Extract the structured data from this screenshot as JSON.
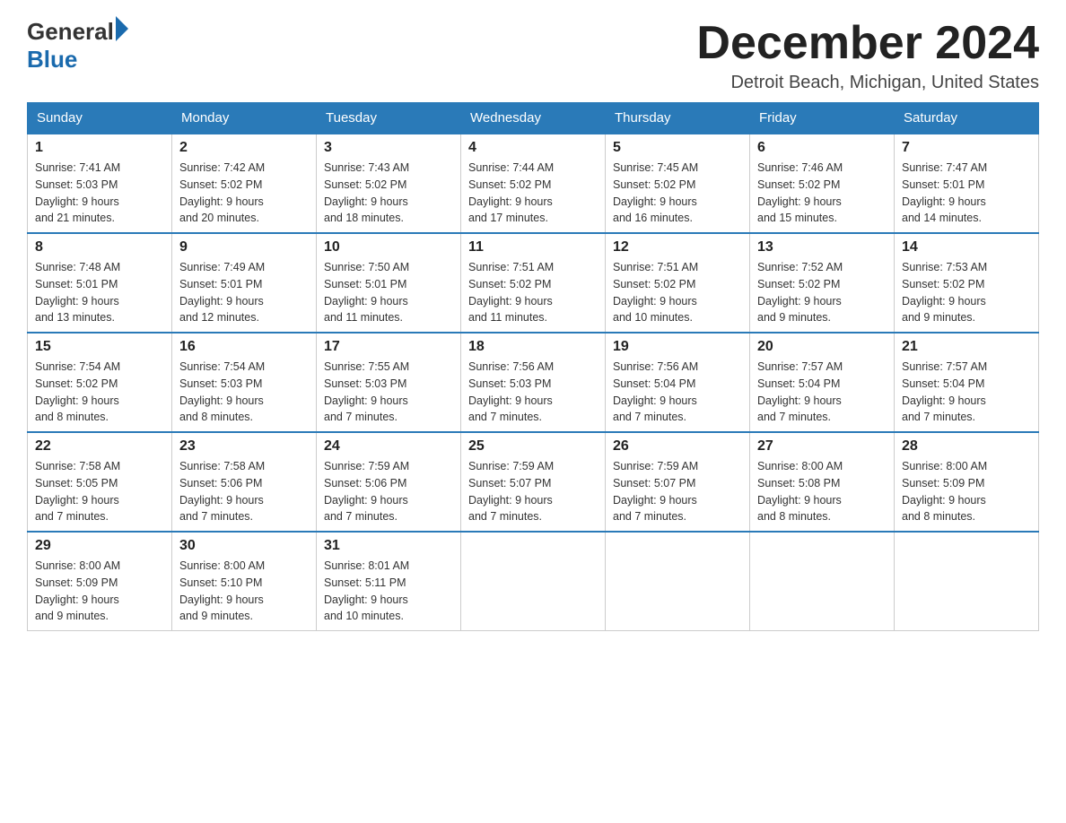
{
  "header": {
    "logo_general": "General",
    "logo_blue": "Blue",
    "month_title": "December 2024",
    "location": "Detroit Beach, Michigan, United States"
  },
  "days_of_week": [
    "Sunday",
    "Monday",
    "Tuesday",
    "Wednesday",
    "Thursday",
    "Friday",
    "Saturday"
  ],
  "weeks": [
    [
      {
        "day": "1",
        "sunrise": "7:41 AM",
        "sunset": "5:03 PM",
        "daylight": "9 hours and 21 minutes."
      },
      {
        "day": "2",
        "sunrise": "7:42 AM",
        "sunset": "5:02 PM",
        "daylight": "9 hours and 20 minutes."
      },
      {
        "day": "3",
        "sunrise": "7:43 AM",
        "sunset": "5:02 PM",
        "daylight": "9 hours and 18 minutes."
      },
      {
        "day": "4",
        "sunrise": "7:44 AM",
        "sunset": "5:02 PM",
        "daylight": "9 hours and 17 minutes."
      },
      {
        "day": "5",
        "sunrise": "7:45 AM",
        "sunset": "5:02 PM",
        "daylight": "9 hours and 16 minutes."
      },
      {
        "day": "6",
        "sunrise": "7:46 AM",
        "sunset": "5:02 PM",
        "daylight": "9 hours and 15 minutes."
      },
      {
        "day": "7",
        "sunrise": "7:47 AM",
        "sunset": "5:01 PM",
        "daylight": "9 hours and 14 minutes."
      }
    ],
    [
      {
        "day": "8",
        "sunrise": "7:48 AM",
        "sunset": "5:01 PM",
        "daylight": "9 hours and 13 minutes."
      },
      {
        "day": "9",
        "sunrise": "7:49 AM",
        "sunset": "5:01 PM",
        "daylight": "9 hours and 12 minutes."
      },
      {
        "day": "10",
        "sunrise": "7:50 AM",
        "sunset": "5:01 PM",
        "daylight": "9 hours and 11 minutes."
      },
      {
        "day": "11",
        "sunrise": "7:51 AM",
        "sunset": "5:02 PM",
        "daylight": "9 hours and 11 minutes."
      },
      {
        "day": "12",
        "sunrise": "7:51 AM",
        "sunset": "5:02 PM",
        "daylight": "9 hours and 10 minutes."
      },
      {
        "day": "13",
        "sunrise": "7:52 AM",
        "sunset": "5:02 PM",
        "daylight": "9 hours and 9 minutes."
      },
      {
        "day": "14",
        "sunrise": "7:53 AM",
        "sunset": "5:02 PM",
        "daylight": "9 hours and 9 minutes."
      }
    ],
    [
      {
        "day": "15",
        "sunrise": "7:54 AM",
        "sunset": "5:02 PM",
        "daylight": "9 hours and 8 minutes."
      },
      {
        "day": "16",
        "sunrise": "7:54 AM",
        "sunset": "5:03 PM",
        "daylight": "9 hours and 8 minutes."
      },
      {
        "day": "17",
        "sunrise": "7:55 AM",
        "sunset": "5:03 PM",
        "daylight": "9 hours and 7 minutes."
      },
      {
        "day": "18",
        "sunrise": "7:56 AM",
        "sunset": "5:03 PM",
        "daylight": "9 hours and 7 minutes."
      },
      {
        "day": "19",
        "sunrise": "7:56 AM",
        "sunset": "5:04 PM",
        "daylight": "9 hours and 7 minutes."
      },
      {
        "day": "20",
        "sunrise": "7:57 AM",
        "sunset": "5:04 PM",
        "daylight": "9 hours and 7 minutes."
      },
      {
        "day": "21",
        "sunrise": "7:57 AM",
        "sunset": "5:04 PM",
        "daylight": "9 hours and 7 minutes."
      }
    ],
    [
      {
        "day": "22",
        "sunrise": "7:58 AM",
        "sunset": "5:05 PM",
        "daylight": "9 hours and 7 minutes."
      },
      {
        "day": "23",
        "sunrise": "7:58 AM",
        "sunset": "5:06 PM",
        "daylight": "9 hours and 7 minutes."
      },
      {
        "day": "24",
        "sunrise": "7:59 AM",
        "sunset": "5:06 PM",
        "daylight": "9 hours and 7 minutes."
      },
      {
        "day": "25",
        "sunrise": "7:59 AM",
        "sunset": "5:07 PM",
        "daylight": "9 hours and 7 minutes."
      },
      {
        "day": "26",
        "sunrise": "7:59 AM",
        "sunset": "5:07 PM",
        "daylight": "9 hours and 7 minutes."
      },
      {
        "day": "27",
        "sunrise": "8:00 AM",
        "sunset": "5:08 PM",
        "daylight": "9 hours and 8 minutes."
      },
      {
        "day": "28",
        "sunrise": "8:00 AM",
        "sunset": "5:09 PM",
        "daylight": "9 hours and 8 minutes."
      }
    ],
    [
      {
        "day": "29",
        "sunrise": "8:00 AM",
        "sunset": "5:09 PM",
        "daylight": "9 hours and 9 minutes."
      },
      {
        "day": "30",
        "sunrise": "8:00 AM",
        "sunset": "5:10 PM",
        "daylight": "9 hours and 9 minutes."
      },
      {
        "day": "31",
        "sunrise": "8:01 AM",
        "sunset": "5:11 PM",
        "daylight": "9 hours and 10 minutes."
      },
      null,
      null,
      null,
      null
    ]
  ],
  "labels": {
    "sunrise_prefix": "Sunrise: ",
    "sunset_prefix": "Sunset: ",
    "daylight_prefix": "Daylight: "
  }
}
